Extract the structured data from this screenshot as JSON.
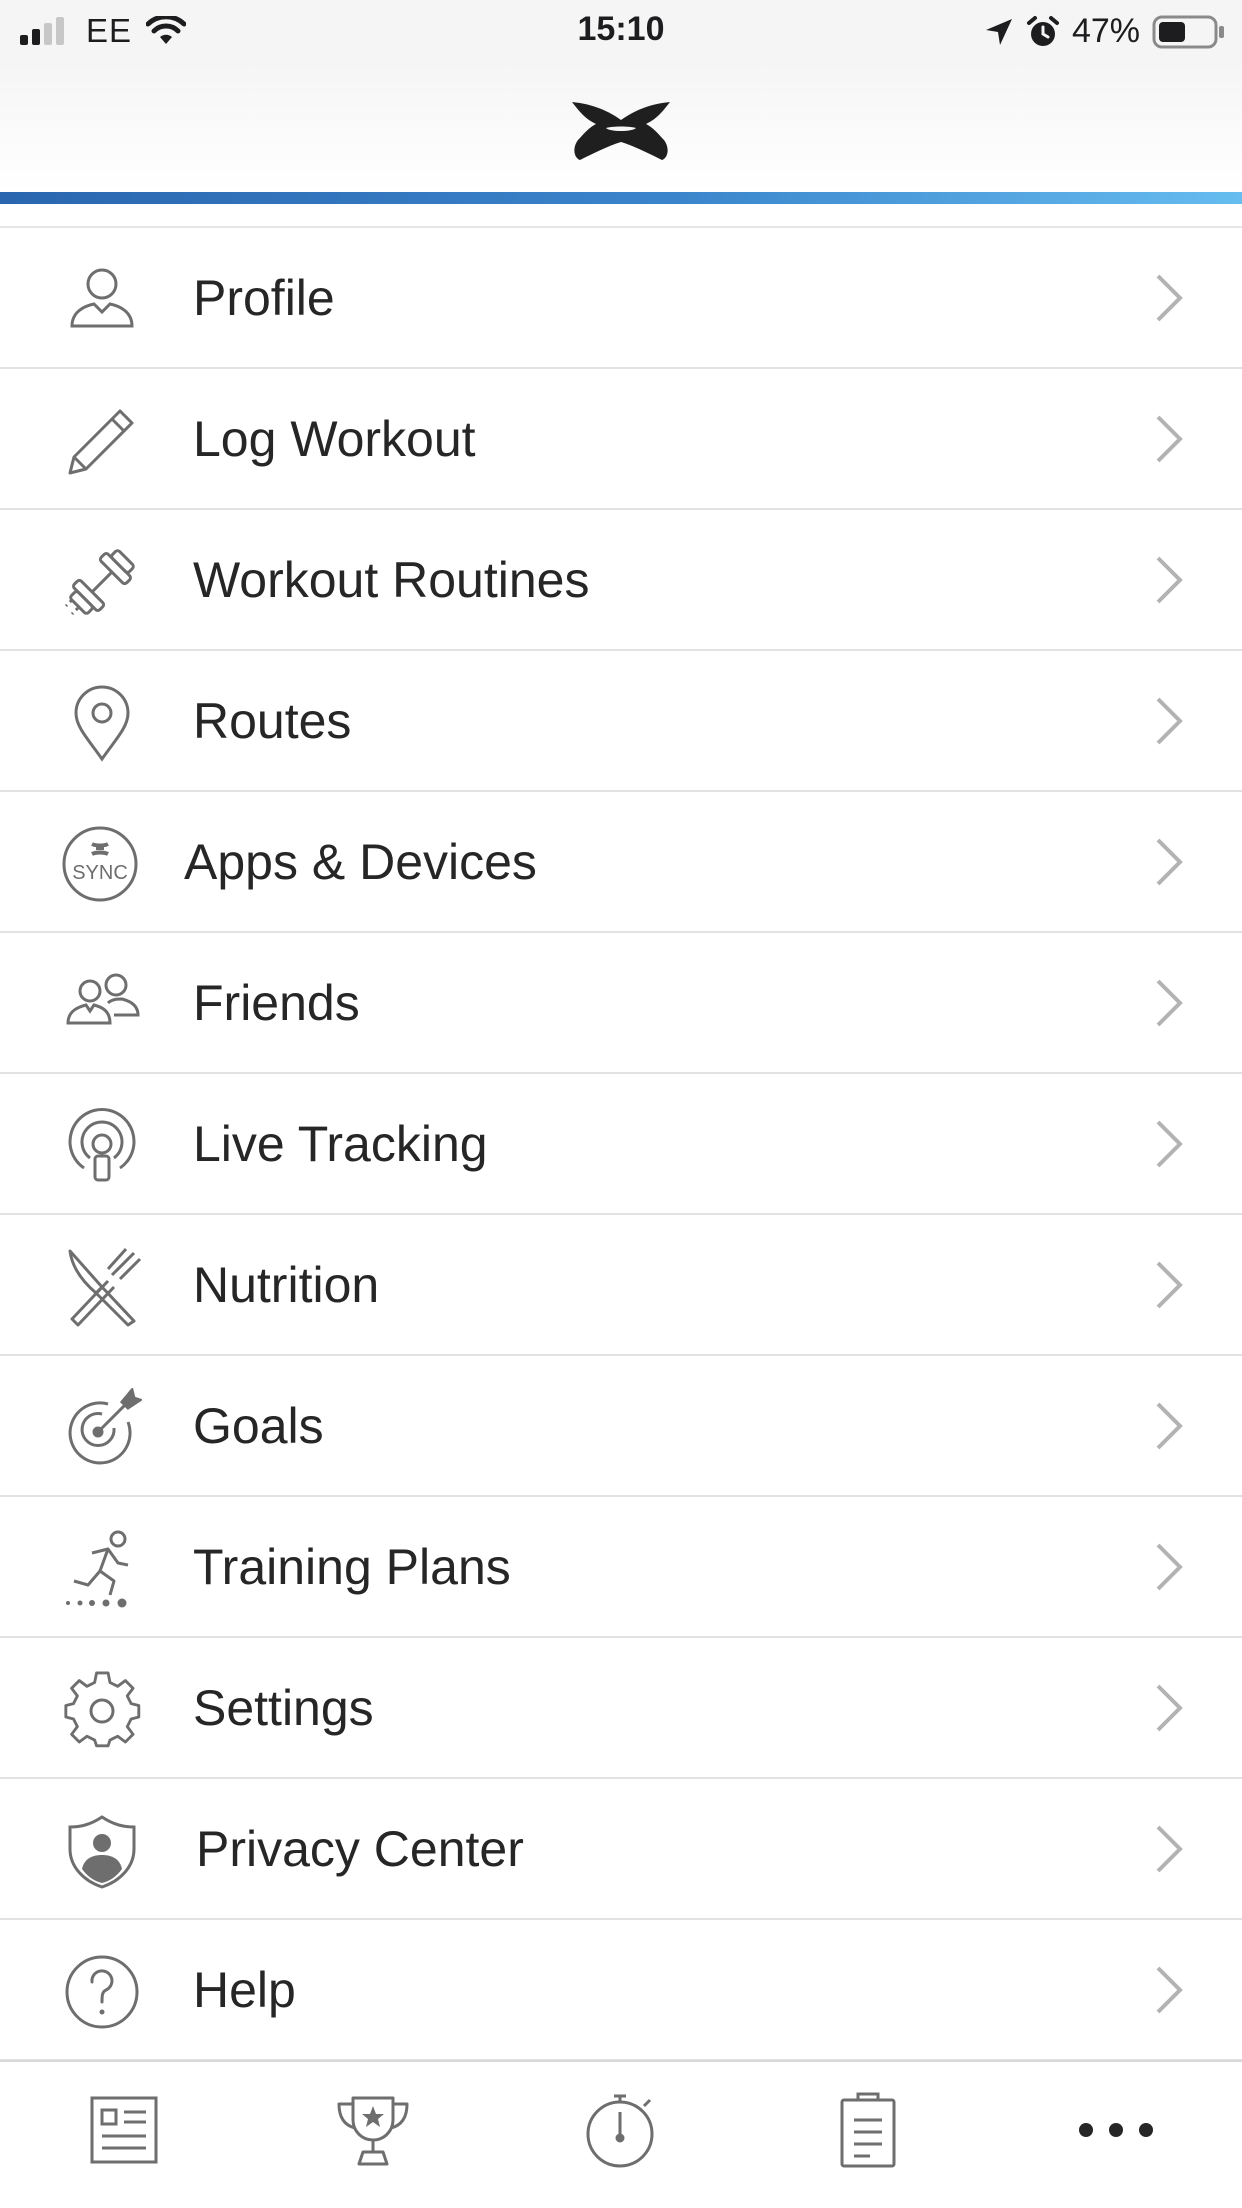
{
  "status_bar": {
    "carrier": "EE",
    "time": "15:10",
    "battery": "47%"
  },
  "header": {
    "logo_icon": "under-armour-logo"
  },
  "menu": {
    "items": [
      {
        "label": "Profile",
        "icon": "profile-icon"
      },
      {
        "label": "Log Workout",
        "icon": "pencil-icon"
      },
      {
        "label": "Workout Routines",
        "icon": "dumbbell-icon"
      },
      {
        "label": "Routes",
        "icon": "map-pin-icon"
      },
      {
        "label": "Apps & Devices",
        "icon": "sync-icon",
        "icon_text": "SYNC"
      },
      {
        "label": "Friends",
        "icon": "friends-icon"
      },
      {
        "label": "Live Tracking",
        "icon": "live-tracking-icon"
      },
      {
        "label": "Nutrition",
        "icon": "knife-fork-icon"
      },
      {
        "label": "Goals",
        "icon": "target-icon"
      },
      {
        "label": "Training Plans",
        "icon": "runner-icon"
      },
      {
        "label": "Settings",
        "icon": "gear-icon"
      },
      {
        "label": "Privacy Center",
        "icon": "shield-user-icon"
      },
      {
        "label": "Help",
        "icon": "question-icon"
      }
    ]
  },
  "tab_bar": {
    "tabs": [
      {
        "icon": "feed-icon"
      },
      {
        "icon": "trophy-icon"
      },
      {
        "icon": "stopwatch-icon"
      },
      {
        "icon": "clipboard-icon"
      },
      {
        "icon": "more-icon"
      }
    ]
  },
  "colors": {
    "accent_start": "#2a66b0",
    "accent_end": "#66bdf0",
    "icon": "#6e6e6e",
    "chevron": "#b3b3b3"
  }
}
